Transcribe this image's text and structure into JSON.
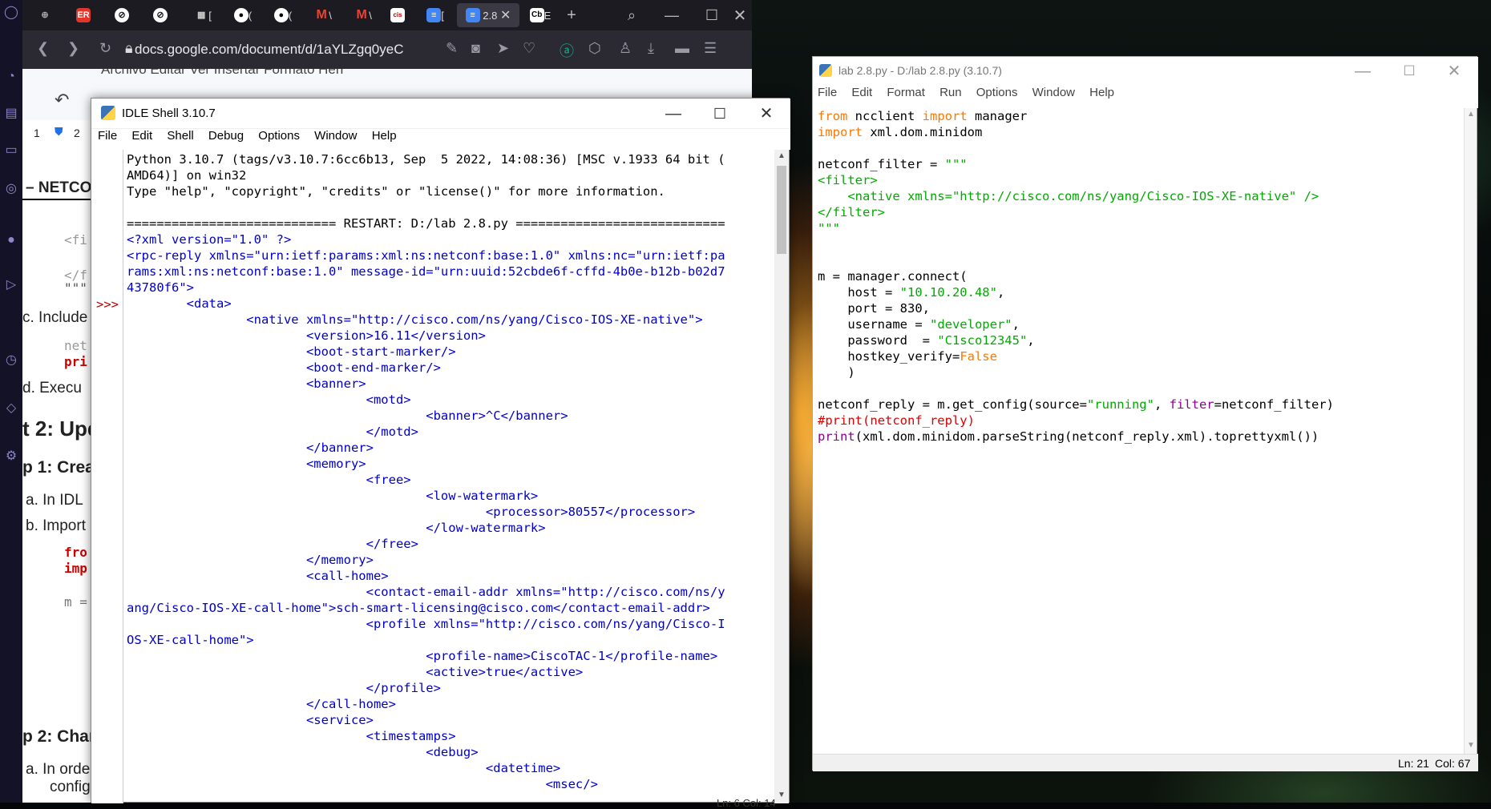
{
  "browser": {
    "url": "docs.google.com/document/d/1aYLZgq0yeC",
    "tabs": [
      {
        "label": "",
        "icon": "gamepad-icon"
      },
      {
        "label": "",
        "icon": "er-icon"
      },
      {
        "label": "",
        "icon": "globe-icon"
      },
      {
        "label": "",
        "icon": "globe-icon"
      },
      {
        "label": "[",
        "icon": "doc-icon"
      },
      {
        "label": "(",
        "icon": "github-icon"
      },
      {
        "label": "(",
        "icon": "github-icon"
      },
      {
        "label": "\\",
        "icon": "gmail-icon"
      },
      {
        "label": "\\",
        "icon": "gmail-icon"
      },
      {
        "label": "",
        "icon": "cisco-icon"
      },
      {
        "label": "[",
        "icon": "gdocs-icon"
      },
      {
        "label": "2.8",
        "icon": "gdocs-icon"
      },
      {
        "label": "E",
        "icon": "cb-icon"
      }
    ],
    "docs_menu": "Archivo   Editar   Ver   Insertar   Formato   Herr",
    "doc_fragments": [
      "1",
      "2",
      "– NETCO",
      "<fi",
      "</f",
      "\"\"\"",
      "c.  Include",
      "net",
      "pri",
      "d.  Execu",
      "t 2: Upd",
      "p 1: Creat",
      "a.  In IDL",
      "b.  Import",
      "fro",
      "imp",
      "m =",
      "p 2: Chan",
      "a.  In orde",
      "config"
    ]
  },
  "shell": {
    "title": "IDLE Shell 3.10.7",
    "menu": [
      "File",
      "Edit",
      "Shell",
      "Debug",
      "Options",
      "Window",
      "Help"
    ],
    "prompt": ">>>",
    "status": "Ln: 6   Col: 14",
    "lines": [
      "Python 3.10.7 (tags/v3.10.7:6cc6b13, Sep  5 2022, 14:08:36) [MSC v.1933 64 bit (",
      "AMD64)] on win32",
      "Type \"help\", \"copyright\", \"credits\" or \"license()\" for more information.",
      "",
      "============================ RESTART: D:/lab 2.8.py ============================",
      "<?xml version=\"1.0\" ?>",
      "<rpc-reply xmlns=\"urn:ietf:params:xml:ns:netconf:base:1.0\" xmlns:nc=\"urn:ietf:pa",
      "rams:xml:ns:netconf:base:1.0\" message-id=\"urn:uuid:52cbde6f-cffd-4b0e-b12b-b02d7",
      "43780f6\">",
      "        <data>",
      "                <native xmlns=\"http://cisco.com/ns/yang/Cisco-IOS-XE-native\">",
      "                        <version>16.11</version>",
      "                        <boot-start-marker/>",
      "                        <boot-end-marker/>",
      "                        <banner>",
      "                                <motd>",
      "                                        <banner>^C</banner>",
      "                                </motd>",
      "                        </banner>",
      "                        <memory>",
      "                                <free>",
      "                                        <low-watermark>",
      "                                                <processor>80557</processor>",
      "                                        </low-watermark>",
      "                                </free>",
      "                        </memory>",
      "                        <call-home>",
      "                                <contact-email-addr xmlns=\"http://cisco.com/ns/y",
      "ang/Cisco-IOS-XE-call-home\">sch-smart-licensing@cisco.com</contact-email-addr>",
      "                                <profile xmlns=\"http://cisco.com/ns/yang/Cisco-I",
      "OS-XE-call-home\">",
      "                                        <profile-name>CiscoTAC-1</profile-name>",
      "                                        <active>true</active>",
      "                                </profile>",
      "                        </call-home>",
      "                        <service>",
      "                                <timestamps>",
      "                                        <debug>",
      "                                                <datetime>",
      "                                                        <msec/>"
    ]
  },
  "editor": {
    "title": "lab 2.8.py - D:/lab 2.8.py (3.10.7)",
    "menu": [
      "File",
      "Edit",
      "Format",
      "Run",
      "Options",
      "Window",
      "Help"
    ],
    "status_ln": "Ln: 21",
    "status_col": "Col: 67",
    "code": {
      "l1_kw1": "from",
      "l1_a": " ncclient ",
      "l1_kw2": "import",
      "l1_b": " manager",
      "l2_kw": "import",
      "l2_a": " xml.dom.minidom",
      "l4_a": "netconf_filter = ",
      "l4_s": "\"\"\"",
      "l5_s": "<filter>",
      "l6_s": "    <native xmlns=\"http://cisco.com/ns/yang/Cisco-IOS-XE-native\" />",
      "l7_s": "</filter>",
      "l8_s": "\"\"\"",
      "l11_a": "m = manager.connect(",
      "l12_a": "    host = ",
      "l12_s": "\"10.10.20.48\"",
      "l12_b": ",",
      "l13_a": "    port = 830,",
      "l14_a": "    username = ",
      "l14_s": "\"developer\"",
      "l14_b": ",",
      "l15_a": "    password  = ",
      "l15_s": "\"C1sco12345\"",
      "l15_b": ",",
      "l16_a": "    hostkey_verify=",
      "l16_k": "False",
      "l17_a": "    )",
      "l19_a": "netconf_reply = m.get_config(source=",
      "l19_s": "\"running\"",
      "l19_b": ", ",
      "l19_f": "filter",
      "l19_c": "=netconf_filter)",
      "l20_c": "#print(netconf_reply)",
      "l21_bi": "print",
      "l21_a": "(xml.dom.minidom.parseString(netconf_reply.xml).toprettyxml())"
    }
  },
  "colors": {
    "keyword": "#ff7700",
    "string": "#00aa00",
    "builtin": "#900090",
    "comment": "#dd0000",
    "shell_output": "#0000cc",
    "browser_chrome": "#1c1b22"
  }
}
